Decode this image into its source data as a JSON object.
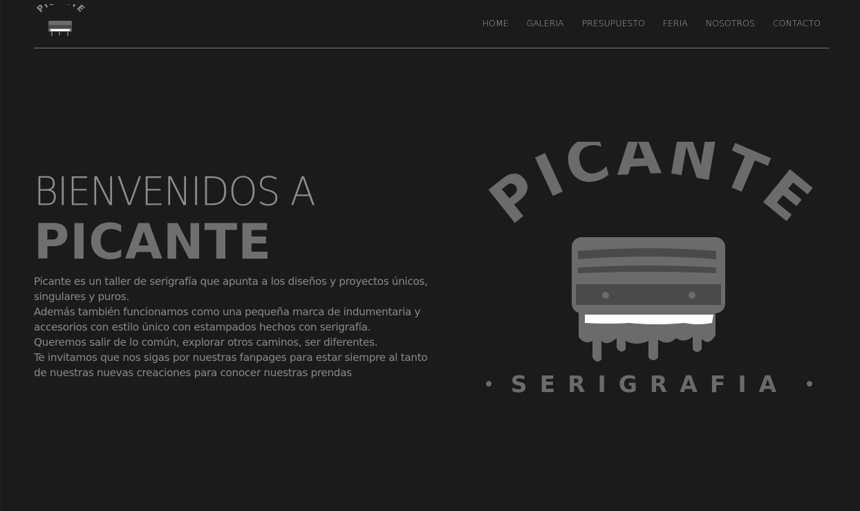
{
  "header": {
    "logo_alt": "Picante",
    "nav": [
      {
        "label": "HOME"
      },
      {
        "label": "GALERIA"
      },
      {
        "label": "PRESUPUESTO"
      },
      {
        "label": "FERIA"
      },
      {
        "label": "NOSOTROS"
      },
      {
        "label": "CONTACTO"
      }
    ]
  },
  "hero": {
    "welcome": "BIENVENIDOS A",
    "brand": "PICANTE",
    "paragraphs": [
      "Picante es un taller de serigrafía que apunta a los diseños y proyectos únicos, singulares y puros.",
      "Además también funcionamos como una pequeña marca de indumentaria y accesorios con estilo único con estampados hechos con serigrafía.",
      "Queremos salir de lo común, explorar otros caminos, ser diferentes.",
      "Te invitamos que nos sigas por nuestras fanpages para estar siempre al tanto de nuestras nuevas creaciones para conocer nuestras prendas"
    ]
  },
  "logo": {
    "arc_text": "PICANTE",
    "subtitle": "SERIGRAFIA",
    "colors": {
      "primary": "#6b6b6b",
      "dark": "#4a4a4a",
      "highlight": "#ffffff"
    }
  }
}
